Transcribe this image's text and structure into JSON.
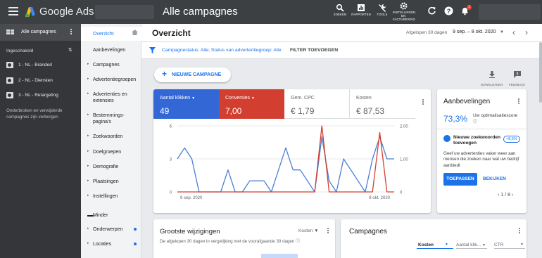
{
  "app": {
    "name": "Google Ads",
    "page_title": "Alle campagnes"
  },
  "toolbar": {
    "search_label": "ZOEKEN",
    "reports_label": "RAPPORTEN",
    "tools_label": "TOOLS",
    "settings_label_1": "INSTELLINGEN",
    "settings_label_2": "EN",
    "settings_label_3": "FACTURERING",
    "notification_count": "1"
  },
  "sidebar": {
    "all_campaigns": "Alle campagnes",
    "enabled_label": "Ingeschakeld",
    "campaigns": [
      "1 - NL - Branded",
      "2 - NL - Diensten",
      "3 - NL - Retargeting"
    ],
    "note": "Onderbroken en verwijderde campagnes zijn verborgen"
  },
  "nav": {
    "items": [
      "Overzicht",
      "Aanbevelingen",
      "Campagnes",
      "Advertentiegroepen",
      "Advertenties en extensies",
      "Bestemmings-pagina's",
      "Zoekwoorden",
      "Doelgroepen",
      "Demografie",
      "Plaatsingen",
      "Instellingen"
    ],
    "less": "Minder",
    "extra": [
      "Onderwerpen",
      "Locaties"
    ]
  },
  "header": {
    "title": "Overzicht",
    "date_label": "Afgelopen 30 dagen",
    "date_range": "9 sep. – 8 okt. 2020"
  },
  "filter": {
    "text": "Campagnestatus: Alle; Status van advertentiegroep: Alle",
    "add": "FILTER TOEVOEGEN"
  },
  "actions": {
    "new_campaign": "NIEUWE CAMPAGNE",
    "download": "DOWNLOADEN",
    "feedback": "FEEDBACK"
  },
  "metrics": [
    {
      "label": "Aantal klikken",
      "value": "49",
      "color": "#3367d6"
    },
    {
      "label": "Conversies",
      "value": "7,00",
      "color": "#d23f31"
    },
    {
      "label": "Gem. CPC",
      "value": "€ 1,79"
    },
    {
      "label": "Kosten",
      "value": "€ 87,53"
    }
  ],
  "chart_data": {
    "type": "line",
    "x_start": "9 sep. 2020",
    "x_end": "8 okt. 2020",
    "x_labels": [
      "9 sep. 2020",
      "8 okt. 2020"
    ],
    "y_left_ticks": [
      "6",
      "3",
      "0"
    ],
    "y_right_ticks": [
      "2,00",
      "1,00",
      "0"
    ],
    "y_left_range": [
      0,
      6
    ],
    "y_right_range": [
      0,
      2
    ],
    "grid": true,
    "series": [
      {
        "name": "Aantal klikken",
        "color": "#4a7fd0",
        "axis": "left",
        "values": [
          3,
          4,
          3,
          0,
          0,
          0,
          0,
          2,
          0,
          0,
          1,
          1,
          1,
          0,
          2,
          4,
          2,
          2,
          1,
          0,
          5,
          1,
          0,
          3,
          2,
          1,
          0,
          3,
          5,
          3,
          3
        ]
      },
      {
        "name": "Conversies",
        "color": "#d23f31",
        "axis": "right",
        "values": [
          0,
          0,
          0,
          0,
          0,
          0,
          0,
          0,
          0,
          0,
          0,
          0,
          0,
          0,
          0,
          0,
          0,
          0,
          0,
          0,
          2,
          0,
          0,
          0,
          0,
          0,
          0,
          0,
          1.8,
          0,
          0
        ]
      }
    ]
  },
  "recs": {
    "title": "Aanbevelingen",
    "score": "73,3%",
    "score_label": "optimalisatiescore",
    "sub_title": "Nieuwe zoekwoorden toevoegen",
    "badge": "+8,6%",
    "desc": "Geef uw advertenties vaker weer aan mensen die zoeken naar wat uw bedrijf aanbiedt",
    "apply": "TOEPASSEN",
    "view": "BEKIJKEN",
    "pager": "1 / 8"
  },
  "changes": {
    "title": "Grootste wijzigingen",
    "metric": "Kosten",
    "note": "De afgelopen 30 dagen in vergelijking met de voorafgaande 30 dagen"
  },
  "campaigns_card": {
    "title": "Campagnes",
    "cols": [
      "Kosten",
      "Aantal klik...",
      "CTR"
    ]
  }
}
